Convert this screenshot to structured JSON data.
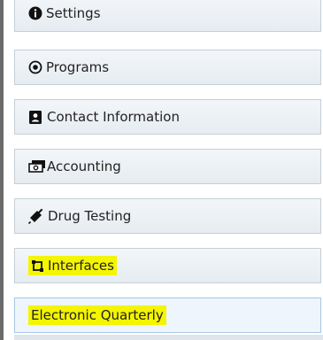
{
  "menu": {
    "items": [
      {
        "label": "Settings",
        "icon": "info-circle-icon"
      },
      {
        "label": "Programs",
        "icon": "target-circle-icon"
      },
      {
        "label": "Contact Information",
        "icon": "contact-card-icon"
      },
      {
        "label": "Accounting",
        "icon": "money-icon"
      },
      {
        "label": "Drug Testing",
        "icon": "syringe-icon"
      },
      {
        "label": "Interfaces",
        "icon": "interfaces-icon",
        "highlighted": true
      },
      {
        "label": "Electronic Quarterly",
        "highlighted": true,
        "active": true
      }
    ]
  },
  "colors": {
    "highlight": "#f4f500",
    "item_border": "#c5cfd8",
    "active_border": "#a8c6e6"
  }
}
